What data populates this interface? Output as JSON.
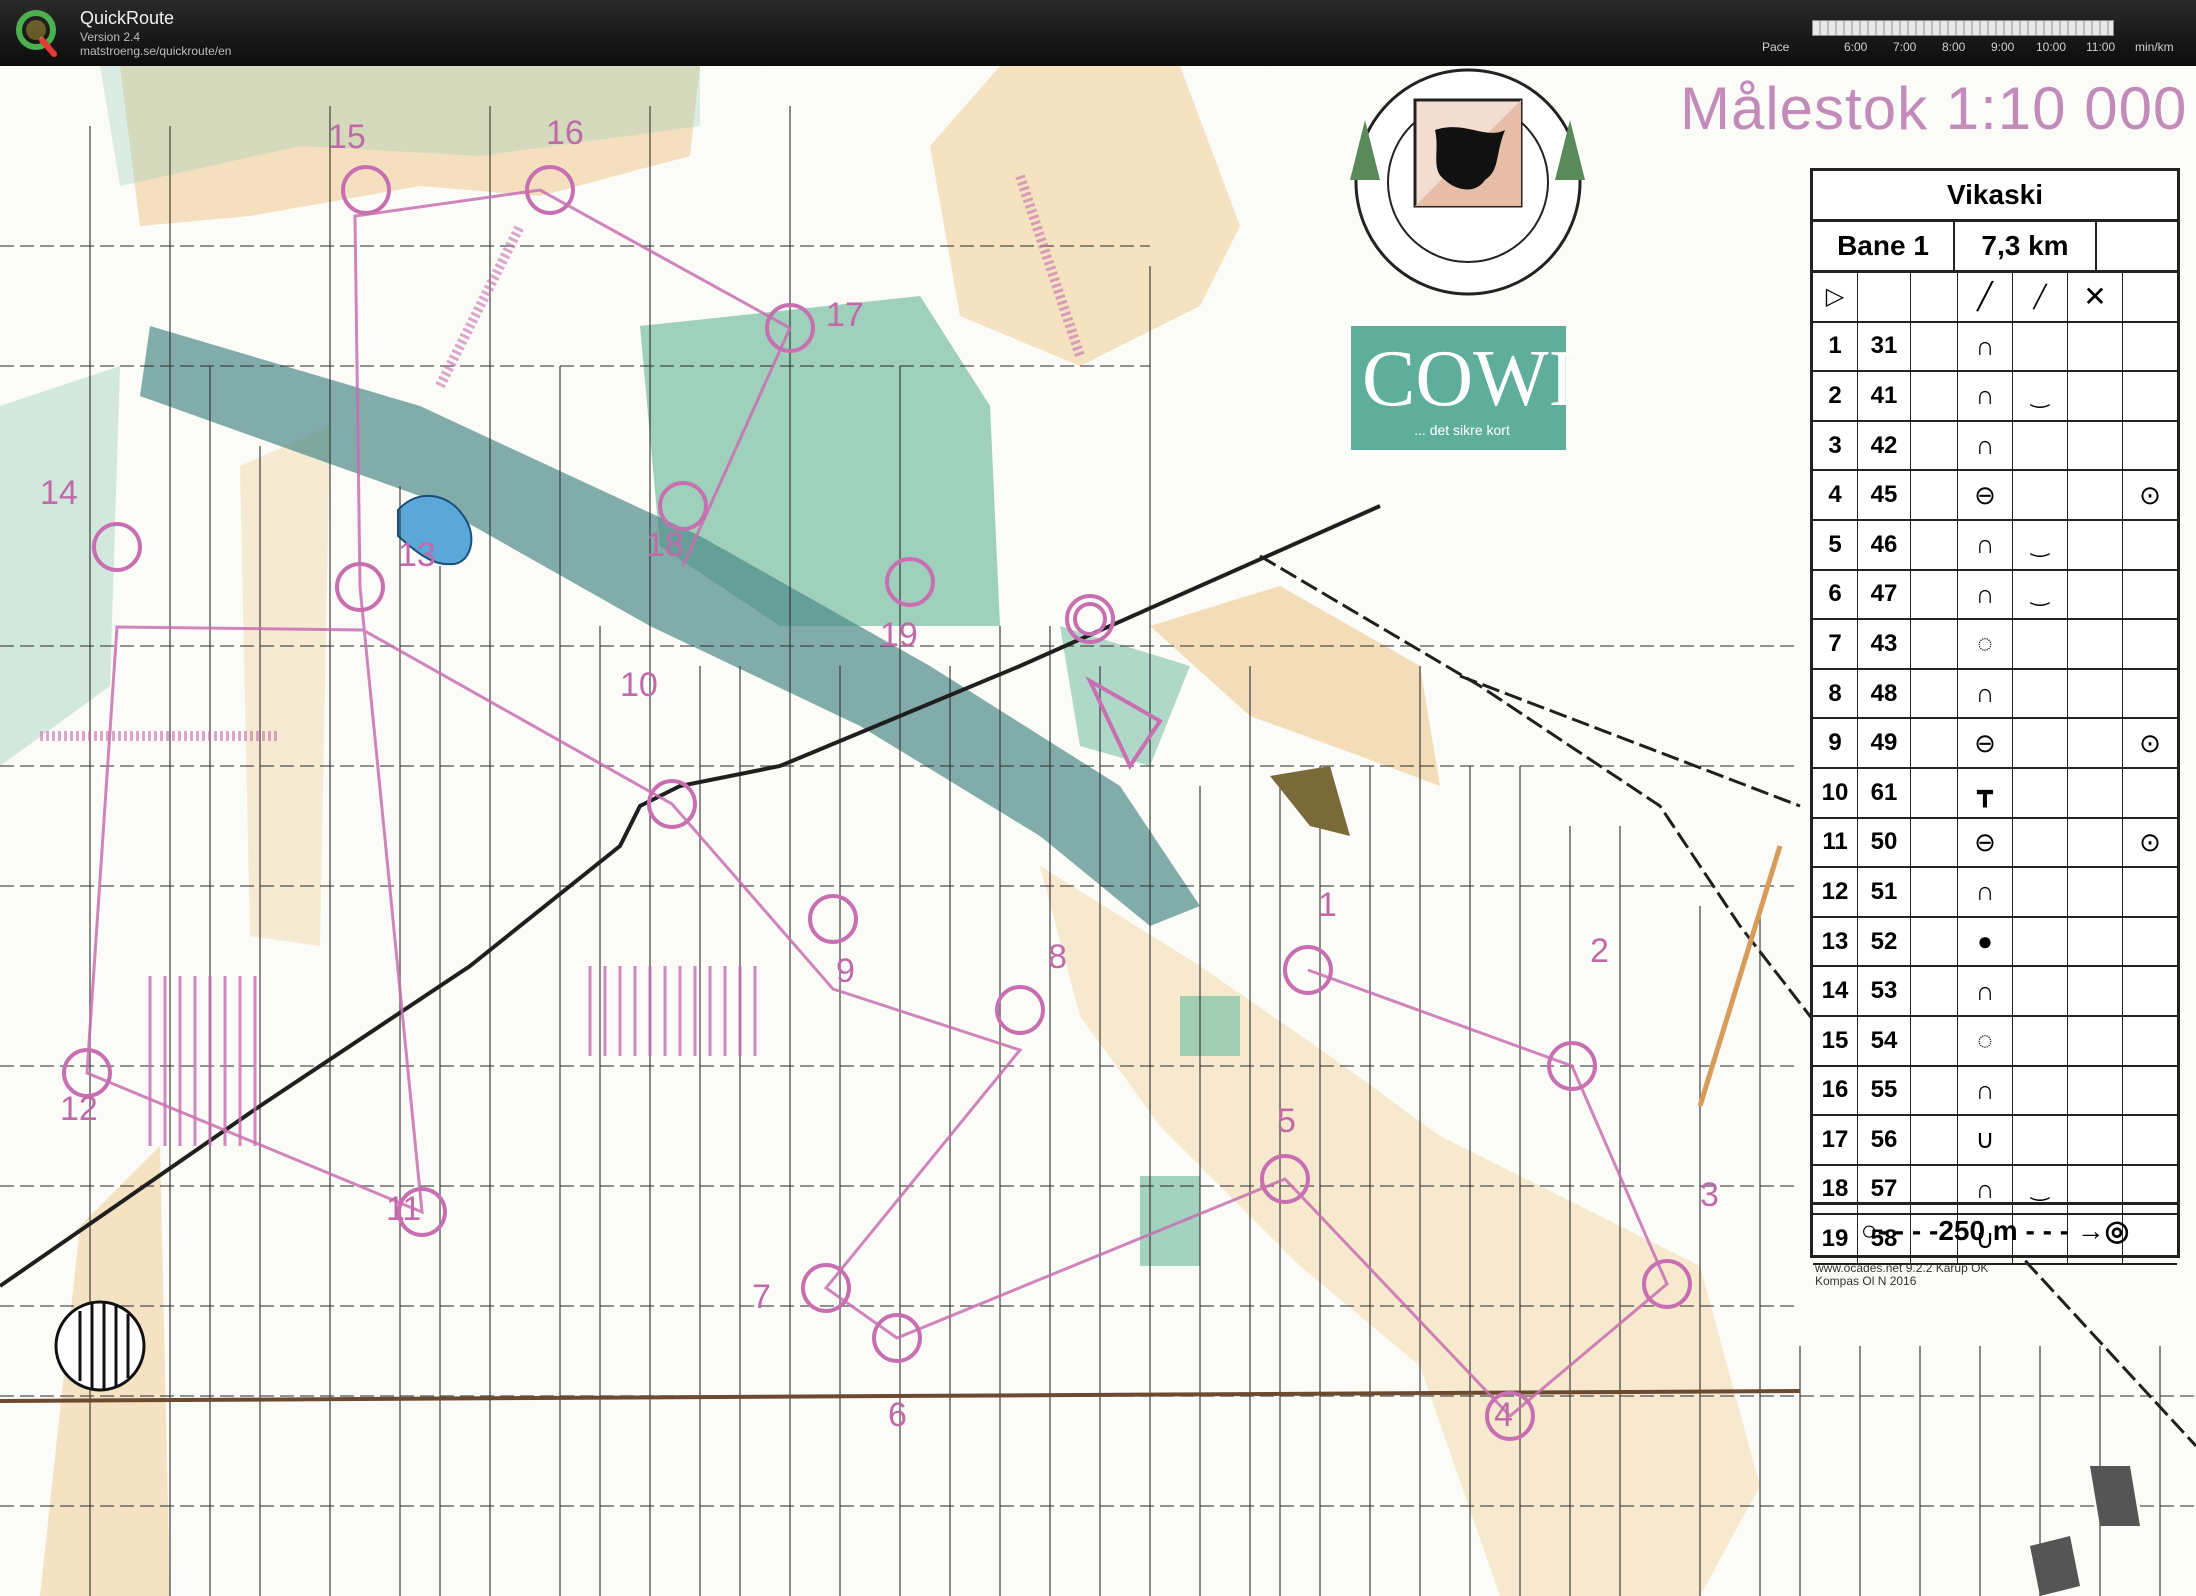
{
  "app": {
    "title": "QuickRoute",
    "version": "Version 2.4",
    "url": "matstroeng.se/quickroute/en"
  },
  "pace": {
    "label": "Pace",
    "ticks": [
      "6:00",
      "7:00",
      "8:00",
      "9:00",
      "10:00",
      "11:00"
    ],
    "unit": "min/km"
  },
  "map": {
    "scale_title": "Målestok 1:10 000",
    "club_name": "ORIENTERINGSKLUB",
    "sponsor": "COWI",
    "sponsor_tagline": "... det sikre kort",
    "credit_line1": "www.ocades.net 9.2.2 Karup OK",
    "credit_line2": "Kompas Ol N 2016"
  },
  "description": {
    "event": "Vikaski",
    "course": "Bane 1",
    "length": "7,3 km",
    "start_symbol": "▷",
    "leg_symbols": [
      "╱",
      "╱",
      "✕"
    ],
    "footer": "○- - - -250 m - - - →◎",
    "controls": [
      {
        "n": "1",
        "code": "31",
        "feature": "∩",
        "appear": "",
        "extra": ""
      },
      {
        "n": "2",
        "code": "41",
        "feature": "∩",
        "appear": "‿",
        "extra": ""
      },
      {
        "n": "3",
        "code": "42",
        "feature": "∩",
        "appear": "",
        "extra": ""
      },
      {
        "n": "4",
        "code": "45",
        "feature": "⊖",
        "appear": "",
        "extra": "⊙"
      },
      {
        "n": "5",
        "code": "46",
        "feature": "∩",
        "appear": "‿",
        "extra": ""
      },
      {
        "n": "6",
        "code": "47",
        "feature": "∩",
        "appear": "‿",
        "extra": ""
      },
      {
        "n": "7",
        "code": "43",
        "feature": "◌",
        "appear": "",
        "extra": ""
      },
      {
        "n": "8",
        "code": "48",
        "feature": "∩",
        "appear": "",
        "extra": ""
      },
      {
        "n": "9",
        "code": "49",
        "feature": "⊖",
        "appear": "",
        "extra": "⊙"
      },
      {
        "n": "10",
        "code": "61",
        "feature": "┳",
        "appear": "",
        "extra": ""
      },
      {
        "n": "11",
        "code": "50",
        "feature": "⊖",
        "appear": "",
        "extra": "⊙"
      },
      {
        "n": "12",
        "code": "51",
        "feature": "∩",
        "appear": "",
        "extra": ""
      },
      {
        "n": "13",
        "code": "52",
        "feature": "●",
        "appear": "",
        "extra": ""
      },
      {
        "n": "14",
        "code": "53",
        "feature": "∩",
        "appear": "",
        "extra": ""
      },
      {
        "n": "15",
        "code": "54",
        "feature": "◌",
        "appear": "",
        "extra": ""
      },
      {
        "n": "16",
        "code": "55",
        "feature": "∩",
        "appear": "",
        "extra": ""
      },
      {
        "n": "17",
        "code": "56",
        "feature": "∪",
        "appear": "",
        "extra": ""
      },
      {
        "n": "18",
        "code": "57",
        "feature": "∩",
        "appear": "‿",
        "extra": ""
      },
      {
        "n": "19",
        "code": "58",
        "feature": "∪",
        "appear": "",
        "extra": ""
      }
    ]
  },
  "course_labels": [
    "1",
    "2",
    "3",
    "4",
    "5",
    "6",
    "7",
    "8",
    "9",
    "10",
    "11",
    "12",
    "13",
    "14",
    "15",
    "16",
    "17",
    "18",
    "19"
  ],
  "colors": {
    "course": "#c86fb1",
    "vegetation": "#7fc1a8",
    "open_land": "#f1d29c",
    "marsh": "#4f8a88",
    "track": "#222222"
  }
}
